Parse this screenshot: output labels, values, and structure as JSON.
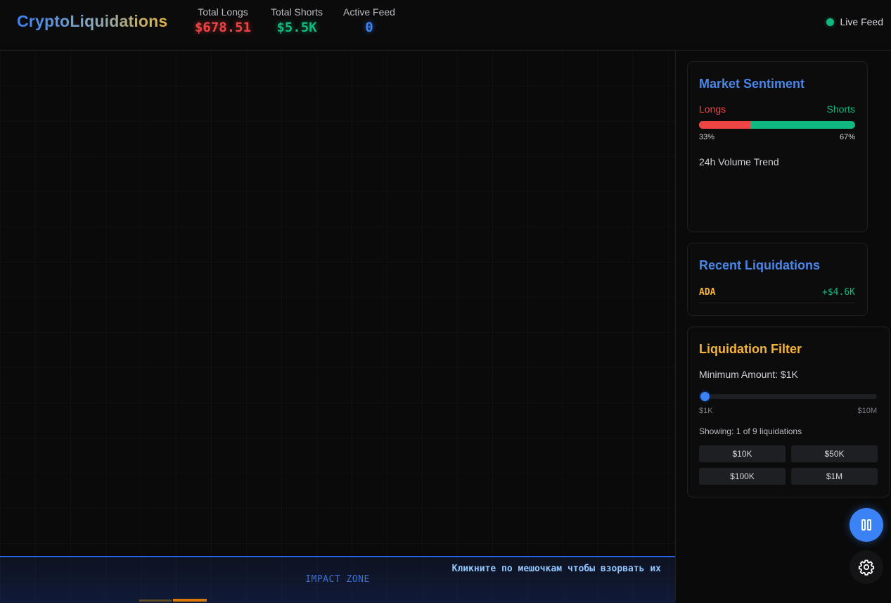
{
  "header": {
    "logo_part1": "Crypto",
    "logo_part2": "Liquidations",
    "stats": {
      "longs_label": "Total Longs",
      "longs_value": "$678.51",
      "shorts_label": "Total Shorts",
      "shorts_value": "$5.5K",
      "feed_label": "Active Feed",
      "feed_value": "0"
    },
    "live_label": "Live Feed"
  },
  "arena": {
    "impact_label": "IMPACT ZONE",
    "hint": "Кликните по мешочкам чтобы взорвать их"
  },
  "sentiment": {
    "title": "Market Sentiment",
    "longs_label": "Longs",
    "shorts_label": "Shorts",
    "longs_pct": "33%",
    "shorts_pct": "67%",
    "longs_fraction": 0.33,
    "volume_title": "24h Volume Trend"
  },
  "recent": {
    "title": "Recent Liquidations",
    "items": [
      {
        "symbol": "ADA",
        "amount": "+$4.6K"
      }
    ]
  },
  "filter": {
    "title": "Liquidation Filter",
    "min_amount": "Minimum Amount: $1K",
    "slider_fraction": 0.0,
    "range_min": "$1K",
    "range_max": "$10M",
    "showing": "Showing: 1 of 9 liquidations",
    "presets": [
      "$10K",
      "$50K",
      "$100K",
      "$1M"
    ]
  },
  "colors": {
    "longs": "#ef4444",
    "shorts": "#10b981",
    "accent": "#3b82f6",
    "amber": "#f5b335"
  },
  "icons": [
    "pause-icon",
    "gear-icon"
  ]
}
